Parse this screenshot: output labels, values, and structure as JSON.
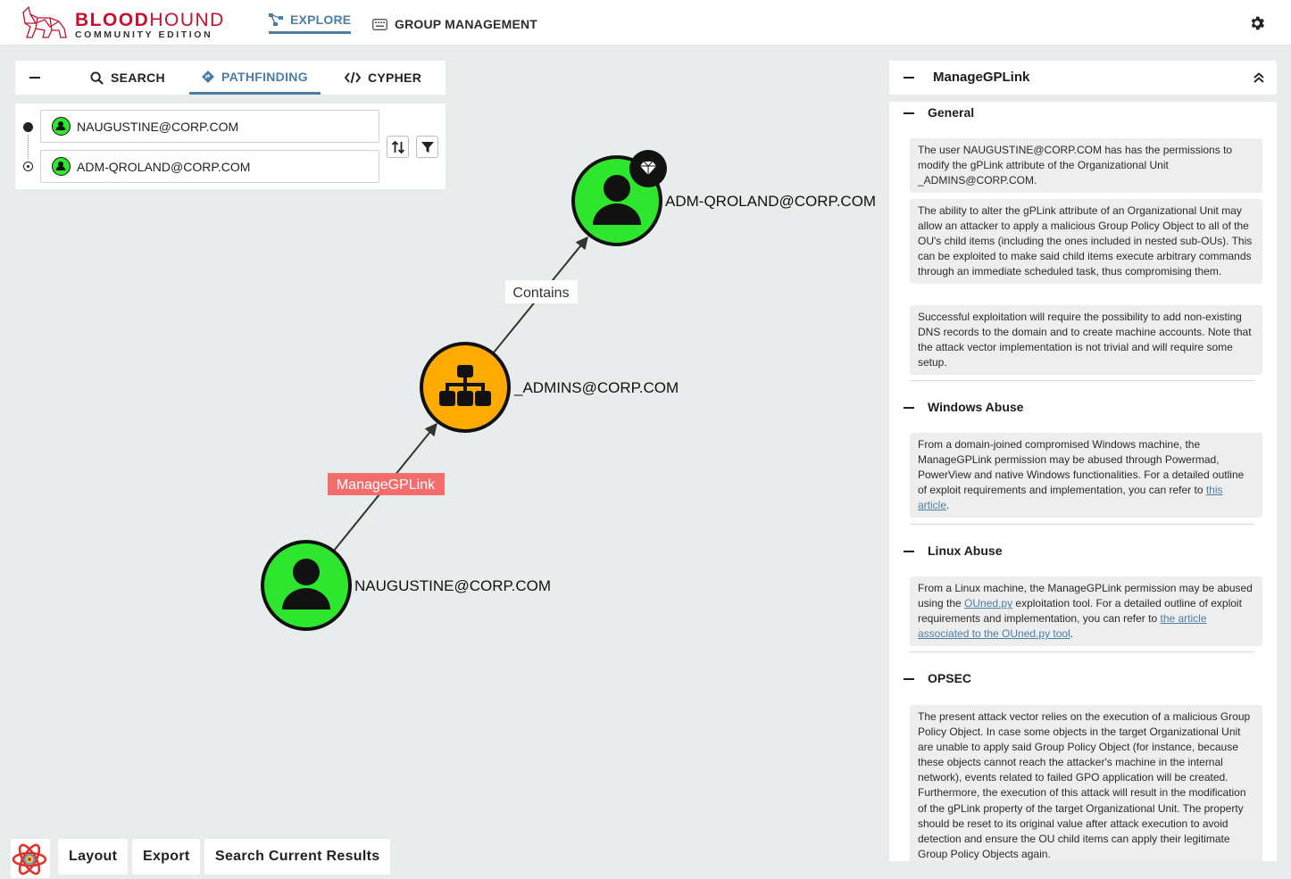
{
  "brand": {
    "name_bold": "BLOOD",
    "name_light": "HOUND",
    "edition": "COMMUNITY EDITION",
    "brand_color": "#c8102e"
  },
  "nav": {
    "explore_label": "EXPLORE",
    "group_management_label": "GROUP MANAGEMENT",
    "active_color": "#4b7ea5"
  },
  "search_panel": {
    "tabs": [
      {
        "label": "SEARCH",
        "icon": "search-icon"
      },
      {
        "label": "PATHFINDING",
        "icon": "diamond-icon",
        "active": true
      },
      {
        "label": "CYPHER",
        "icon": "code-icon"
      }
    ],
    "start_node": "NAUGUSTINE@CORP.COM",
    "end_node": "ADM-QROLAND@CORP.COM"
  },
  "graph": {
    "nodes": [
      {
        "label": "ADM-QROLAND@CORP.COM",
        "kind": "user",
        "color": "#2ee62e",
        "tier_zero": true
      },
      {
        "label": "_ADMINS@CORP.COM",
        "kind": "ou",
        "color": "#ffaa00"
      },
      {
        "label": "NAUGUSTINE@CORP.COM",
        "kind": "user",
        "color": "#2ee62e"
      }
    ],
    "edges": [
      {
        "label": "Contains",
        "highlight": false
      },
      {
        "label": "ManageGPLink",
        "highlight": true,
        "highlight_color": "#f56c6c"
      }
    ]
  },
  "bottom_bar": {
    "layout_label": "Layout",
    "export_label": "Export",
    "search_results_label": "Search Current Results"
  },
  "info_panel": {
    "title": "ManageGPLink",
    "sections": {
      "general": {
        "title": "General",
        "paragraphs": [
          "The user NAUGUSTINE@CORP.COM has has the permissions to modify the gPLink attribute of the Organizational Unit _ADMINS@CORP.COM.",
          "The ability to alter the gPLink attribute of an Organizational Unit may allow an attacker to apply a malicious Group Policy Object to all of the OU's child items (including the ones included in nested sub-OUs). This can be exploited to make said child items execute arbitrary commands through an immediate scheduled task, thus compromising them.",
          "Successful exploitation will require the possibility to add non-existing DNS records to the domain and to create machine accounts. Note that the attack vector implementation is not trivial and will require some setup."
        ]
      },
      "windows": {
        "title": "Windows Abuse",
        "text": "From a domain-joined compromised Windows machine, the ManageGPLink permission may be abused through Powermad, PowerView and native Windows functionalities. For a detailed outline of exploit requirements and implementation, you can refer to ",
        "link": "this article",
        "end": "."
      },
      "linux": {
        "title": "Linux Abuse",
        "text1": "From a Linux machine, the ManageGPLink permission may be abused using the ",
        "link1": "OUned.py",
        "text2": " exploitation tool. For a detailed outline of exploit requirements and implementation, you can refer to ",
        "link2": "the article associated to the OUned.py tool",
        "end": "."
      },
      "opsec": {
        "title": "OPSEC",
        "text": "The present attack vector relies on the execution of a malicious Group Policy Object. In case some objects in the target Organizational Unit are unable to apply said Group Policy Object (for instance, because these objects cannot reach the attacker's machine in the internal network), events related to failed GPO application will be created. Furthermore, the execution of this attack will result in the modification of the gPLink property of the target Organizational Unit. The property should be reset to its original value after attack execution to avoid detection and ensure the OU child items can apply their legitimate Group Policy Objects again."
      }
    }
  }
}
